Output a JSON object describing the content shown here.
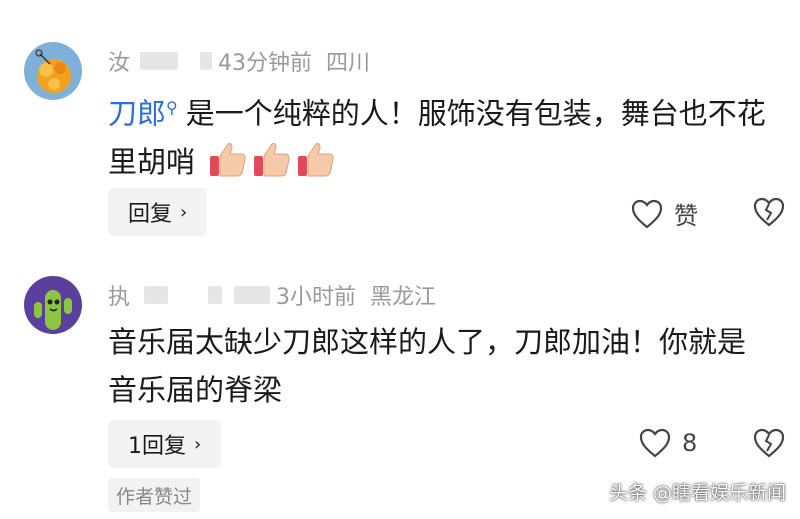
{
  "comments": [
    {
      "username_prefix": "汝",
      "time": "43分钟前",
      "location": "四川",
      "author_tag": "刀郎",
      "text_after_tag": "是一个纯粹的人！服饰没有包装，舞台也不花里胡哨",
      "thumbs": [
        "👍",
        "👍",
        "👍"
      ],
      "reply_label": "回复",
      "like_label": "赞",
      "avatar_icon": "orange-flower-avatar"
    },
    {
      "username_prefix": "执",
      "time": "3小时前",
      "location": "黑龙江",
      "text": "音乐届太缺少刀郎这样的人了，刀郎加油！你就是音乐届的脊梁",
      "reply_label": "1回复",
      "like_count": "8",
      "author_liked": "作者赞过",
      "avatar_icon": "green-cactus-avatar"
    }
  ],
  "watermark": "头条 @瞎看娱乐新闻",
  "colors": {
    "author_link": "#2d6fd8",
    "meta": "#9a9a9a",
    "button_bg": "#f3f3f3"
  }
}
